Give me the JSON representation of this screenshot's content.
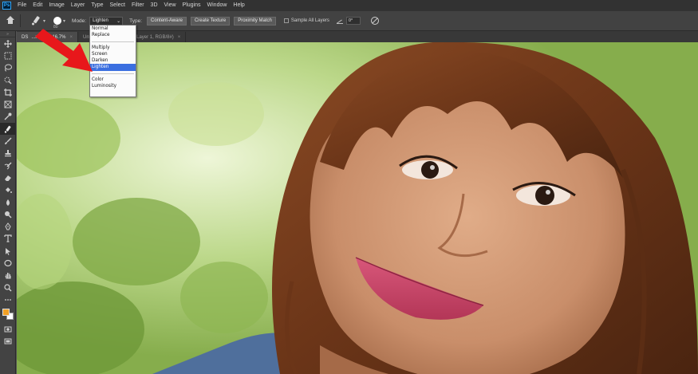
{
  "menubar": {
    "logo": "Ps",
    "items": [
      "File",
      "Edit",
      "Image",
      "Layer",
      "Type",
      "Select",
      "Filter",
      "3D",
      "View",
      "Plugins",
      "Window",
      "Help"
    ]
  },
  "options": {
    "brush_size": "80",
    "mode_label": "Mode:",
    "mode_value": "Lighten",
    "type_label": "Type:",
    "type_buttons": [
      "Content-Aware",
      "Create Texture",
      "Proximity Match"
    ],
    "sample_all_layers": "Sample All Layers",
    "angle_value": "0°"
  },
  "tabs": [
    {
      "title": "DS",
      "partial": "...rodc @ 16.7%",
      "active": true
    },
    {
      "title": "Untitled-1.psd @ 66.7% (Layer 1, RGB/8#)",
      "active": false
    }
  ],
  "mode_dropdown": {
    "groups": [
      [
        "Normal",
        "Replace"
      ],
      [
        "Multiply",
        "Screen",
        "Darken",
        "Lighten"
      ],
      [
        "Color",
        "Luminosity"
      ]
    ],
    "selected": "Lighten"
  },
  "toolbar": {
    "tools": [
      "move-tool",
      "rectangular-marquee-tool",
      "lasso-tool",
      "quick-selection-tool",
      "crop-tool",
      "frame-tool",
      "eyedropper-tool",
      "spot-healing-brush-tool",
      "brush-tool",
      "clone-stamp-tool",
      "history-brush-tool",
      "eraser-tool",
      "paint-bucket-tool",
      "blur-tool",
      "dodge-tool",
      "pen-tool",
      "type-tool",
      "path-selection-tool",
      "ellipse-tool",
      "hand-tool",
      "zoom-tool",
      "more-tools"
    ],
    "active": "spot-healing-brush-tool",
    "foreground_color": "#f1a025",
    "background_color": "#ffffff"
  },
  "colors": {
    "menubar_bg": "#323232",
    "optionsbar_bg": "#424242",
    "toolbar_bg": "#434343",
    "dropdown_highlight": "#3b6fe0",
    "annotation_arrow": "#e8171b"
  }
}
